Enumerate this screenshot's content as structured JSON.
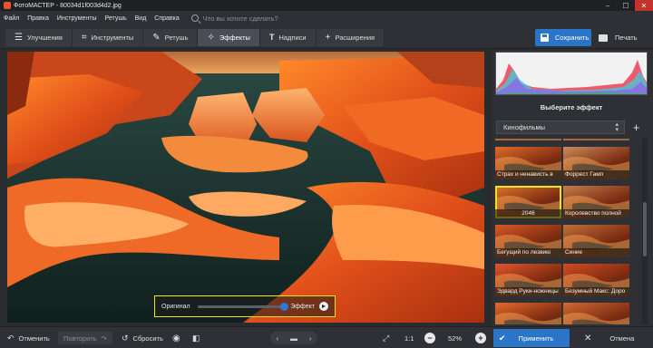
{
  "window": {
    "title": "ФотоМАСТЕР - 80034d1f003d4d2.jpg"
  },
  "window_controls": {
    "minimize": "–",
    "maximize": "☐",
    "close": "✕"
  },
  "menu": {
    "items": [
      "Файл",
      "Правка",
      "Инструменты",
      "Ретушь",
      "Вид",
      "Справка"
    ],
    "search_placeholder": "Что вы хотите сделать?"
  },
  "toolbar": {
    "tabs": [
      {
        "label": "Улучшения",
        "icon": "enhance-icon"
      },
      {
        "label": "Инструменты",
        "icon": "crop-icon"
      },
      {
        "label": "Ретушь",
        "icon": "brush-icon"
      },
      {
        "label": "Эффекты",
        "icon": "magic-wand-icon"
      },
      {
        "label": "Надписи",
        "icon": "text-icon"
      },
      {
        "label": "Расширения",
        "icon": "plus-icon"
      }
    ],
    "active_tab": "Эффекты",
    "save_label": "Сохранить",
    "print_label": "Печать"
  },
  "compare": {
    "original_label": "Оригинал",
    "effect_label": "Эффект"
  },
  "effects_panel": {
    "header": "Выберите эффект",
    "category": "Кинофильмы",
    "thumbnails": [
      {
        "label": ""
      },
      {
        "label": ""
      },
      {
        "label": "Страх и ненависть в"
      },
      {
        "label": "Форрест Гамп"
      },
      {
        "label": "2046"
      },
      {
        "label": "Королевство полной"
      },
      {
        "label": "Бегущий по лезвию"
      },
      {
        "label": "Синие"
      },
      {
        "label": "Эдвард Руки-ножницы"
      },
      {
        "label": "Безумный Макс: Доро"
      },
      {
        "label": ""
      },
      {
        "label": ""
      }
    ],
    "selected": "2046"
  },
  "bottombar": {
    "undo_label": "Отменить",
    "redo_label": "Повторить",
    "reset_label": "Сбросить",
    "zoom_1to1": "1:1",
    "zoom_value": "52%",
    "apply_label": "Применить",
    "cancel_label": "Отмена"
  },
  "colors": {
    "accent": "#2b75c9",
    "highlight": "#f2e21a",
    "background": "#2e3035"
  }
}
